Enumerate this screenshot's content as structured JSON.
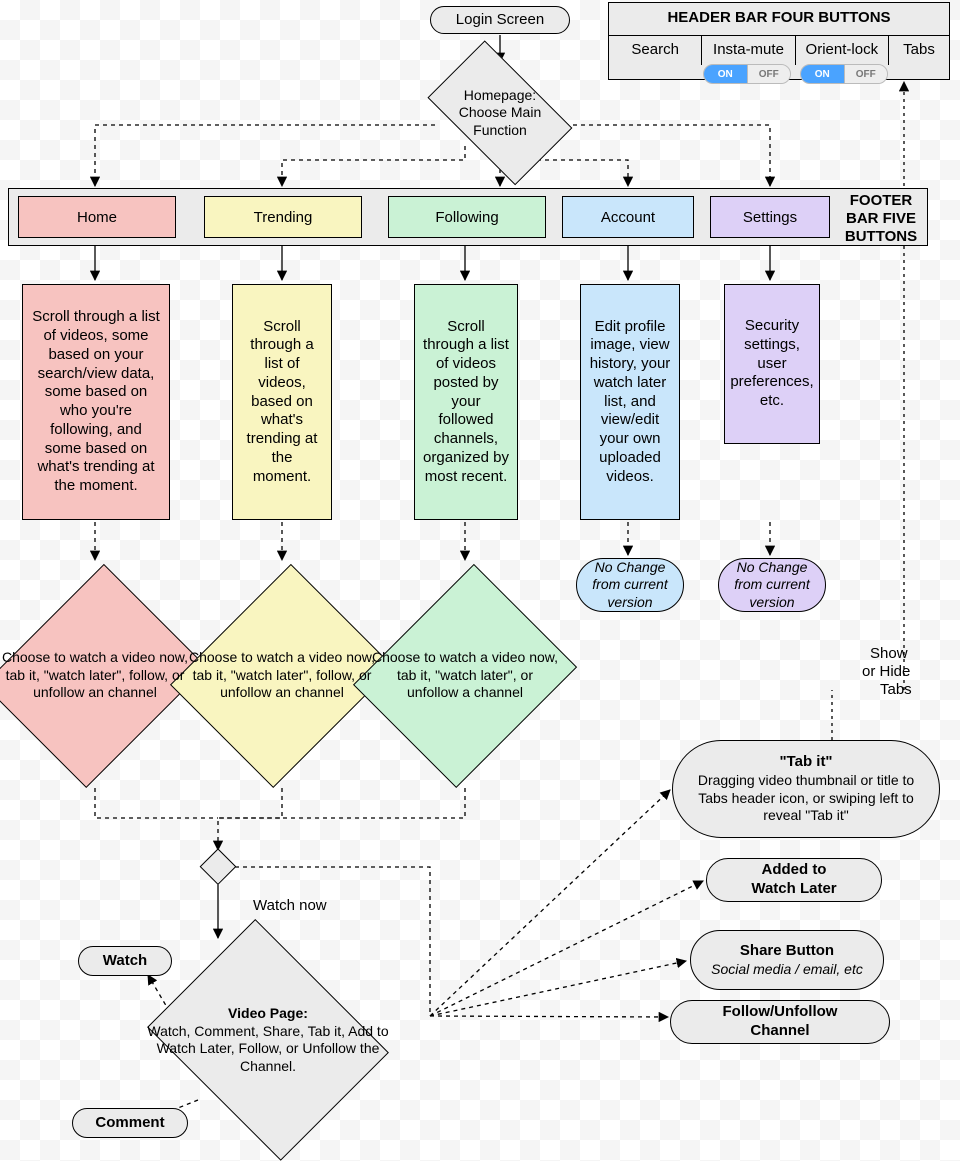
{
  "start": "Login Screen",
  "homepage": "Homepage:\nChoose Main\nFunction",
  "header": {
    "title": "HEADER BAR FOUR BUTTONS",
    "items": [
      "Search",
      "Insta-mute",
      "Orient-lock",
      "Tabs"
    ],
    "toggle_on": "ON",
    "toggle_off": "OFF"
  },
  "footer": {
    "label": "FOOTER\nBAR FIVE\nBUTTONS",
    "tabs": [
      "Home",
      "Trending",
      "Following",
      "Account",
      "Settings"
    ]
  },
  "desc": {
    "home": "Scroll through a list of videos, some based on your search/view data, some based on who you're following, and some based on what's trending at the moment.",
    "trending": "Scroll through a list of videos, based on what's trending at the moment.",
    "following": "Scroll through a list of videos posted by your followed channels, organized by most recent.",
    "account": "Edit profile image, view history, your watch later list, and view/edit your own uploaded videos.",
    "settings": "Security settings, user preferences, etc."
  },
  "choose": {
    "home": "Choose to watch a video now, tab it, \"watch later\", follow, or unfollow an channel",
    "trending": "Choose to watch a video now, tab it, \"watch later\", follow, or unfollow an channel",
    "following": "Choose to watch a video now, tab it, \"watch later\", or unfollow a channel"
  },
  "nochange": "No Change from current version",
  "watch_now": "Watch now",
  "video_page_title": "Video Page:",
  "video_page_body": "Watch, Comment, Share, Tab it, Add to Watch Later, Follow, or Unfollow the Channel.",
  "watch": "Watch",
  "comment": "Comment",
  "show_hide": "Show\nor Hide\nTabs",
  "actions": {
    "tabit_title": "\"Tab it\"",
    "tabit_body": "Dragging video thumbnail or title to Tabs header icon, or swiping left to reveal \"Tab it\"",
    "added": "Added to\nWatch Later",
    "share_title": "Share Button",
    "share_body": "Social media / email, etc",
    "follow": "Follow/Unfollow\nChannel"
  }
}
